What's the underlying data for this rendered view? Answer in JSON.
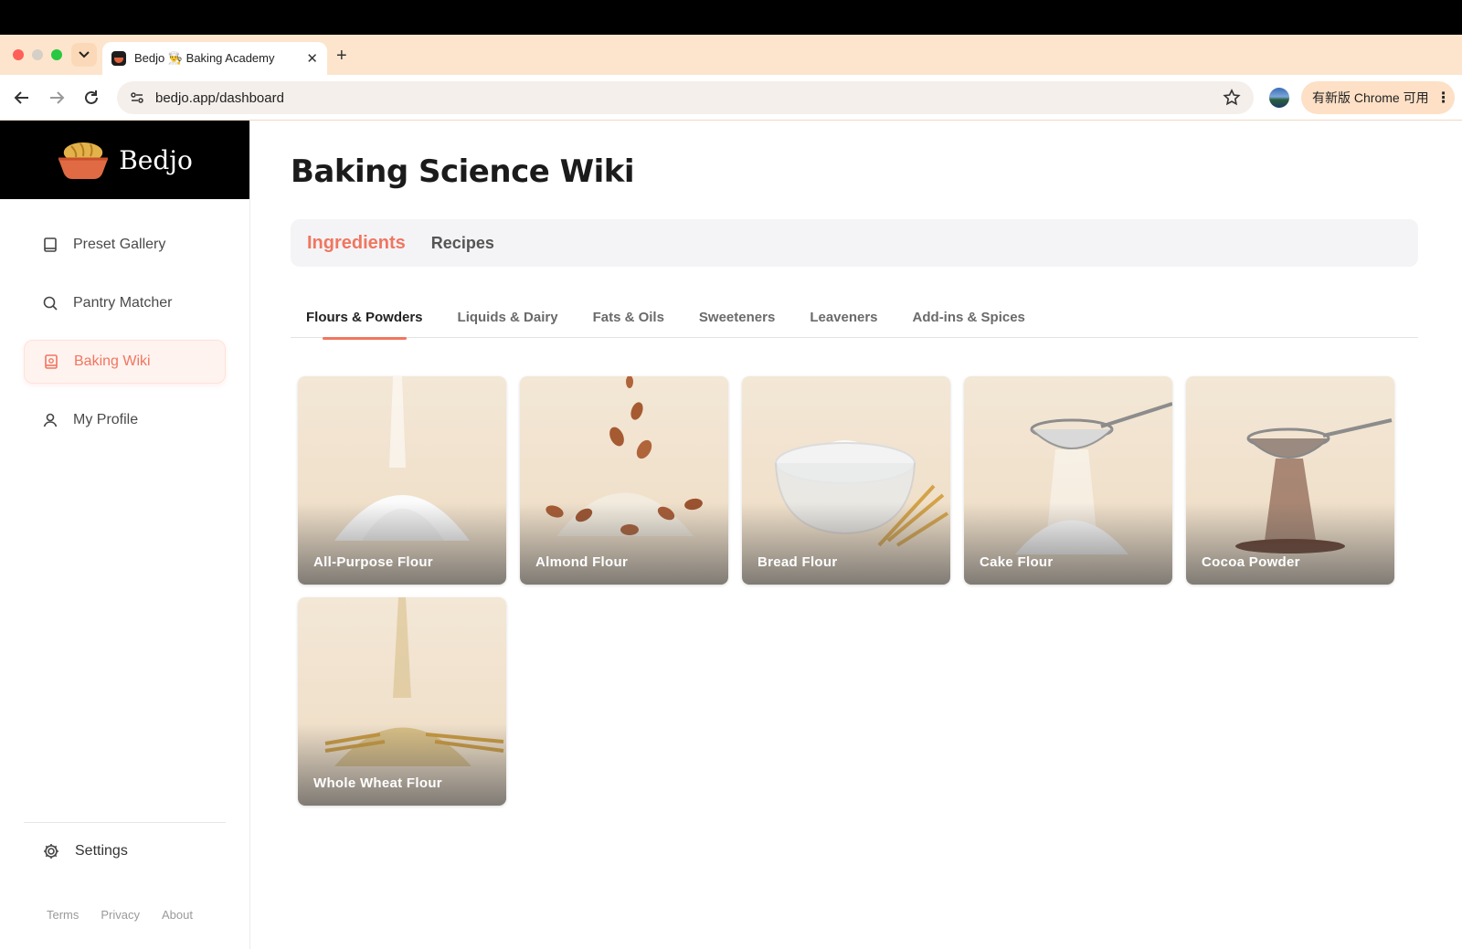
{
  "browser": {
    "tab_title": "Bedjo 👨‍🍳 Baking Academy",
    "url": "bedjo.app/dashboard",
    "update_label": "有新版 Chrome 可用"
  },
  "sidebar": {
    "brand": "Bedjo",
    "items": [
      {
        "label": "Preset Gallery",
        "icon": "book-icon",
        "active": false
      },
      {
        "label": "Pantry Matcher",
        "icon": "search-icon",
        "active": false
      },
      {
        "label": "Baking Wiki",
        "icon": "wiki-book-icon",
        "active": true
      },
      {
        "label": "My Profile",
        "icon": "user-icon",
        "active": false
      }
    ],
    "settings_label": "Settings",
    "footer_links": [
      "Terms",
      "Privacy",
      "About"
    ]
  },
  "main": {
    "title": "Baking Science Wiki",
    "section_tabs": [
      "Ingredients",
      "Recipes"
    ],
    "active_section": "Ingredients",
    "category_tabs": [
      "Flours & Powders",
      "Liquids & Dairy",
      "Fats & Oils",
      "Sweeteners",
      "Leaveners",
      "Add-ins & Spices"
    ],
    "active_category": "Flours & Powders",
    "cards": [
      {
        "label": "All-Purpose Flour"
      },
      {
        "label": "Almond Flour"
      },
      {
        "label": "Bread Flour"
      },
      {
        "label": "Cake Flour"
      },
      {
        "label": "Cocoa Powder"
      },
      {
        "label": "Whole Wheat Flour"
      }
    ]
  },
  "colors": {
    "accent": "#f0765f",
    "chrome_tabstrip": "#fde5cd",
    "sidebar_header": "#000000"
  }
}
